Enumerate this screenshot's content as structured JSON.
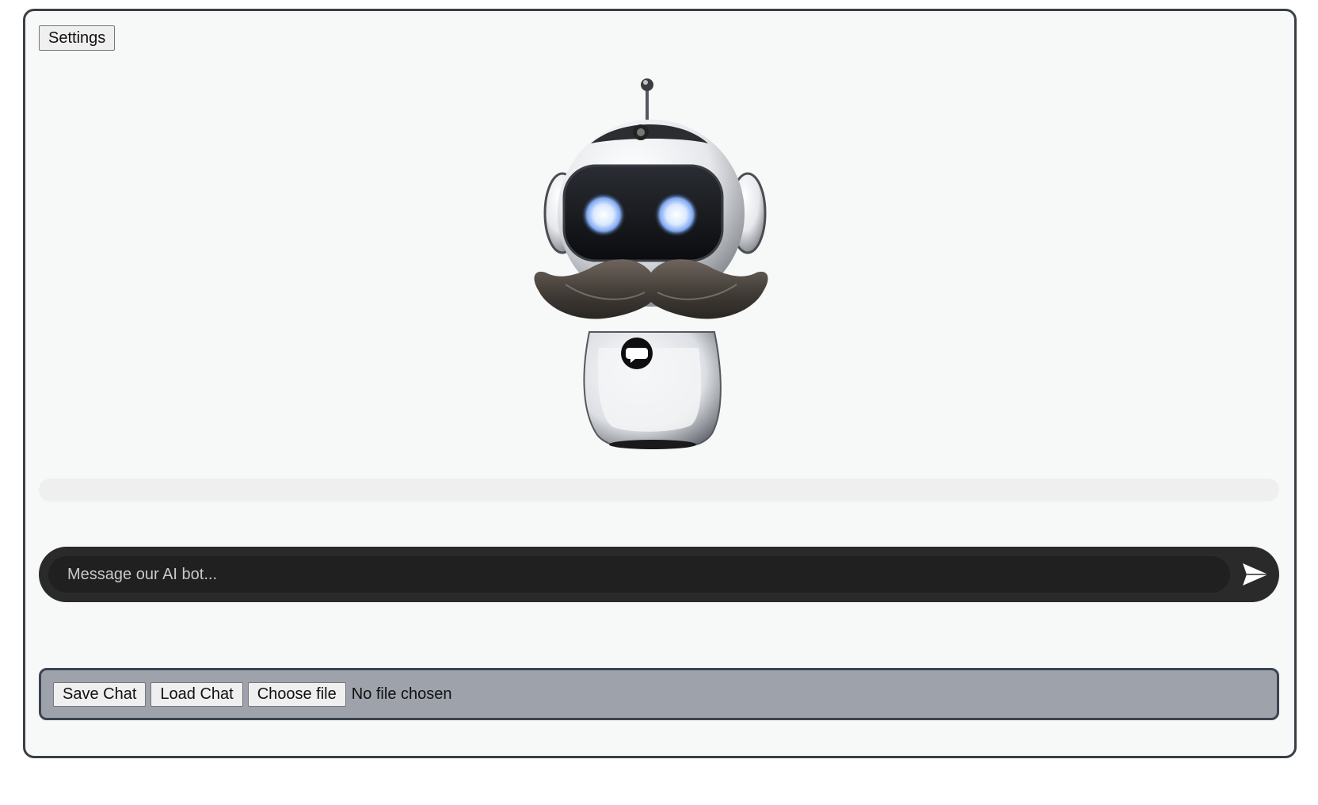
{
  "settings": {
    "label": "Settings"
  },
  "bot": {
    "description": "robot-mascot-with-mustache",
    "badge_text": "chat"
  },
  "progress": {
    "fraction": 0.0
  },
  "composer": {
    "placeholder": "Message our AI bot...",
    "value": "",
    "send_icon": "send-icon"
  },
  "toolbar": {
    "save_label": "Save Chat",
    "load_label": "Load Chat",
    "choose_label": "Choose file",
    "file_status": "No file chosen"
  },
  "colors": {
    "frame_border": "#3b3f45",
    "app_background": "#f7f8f8",
    "composer_background": "#2a2a2a",
    "toolbar_background": "#9da2ab",
    "toolbar_border": "#3b4450"
  }
}
